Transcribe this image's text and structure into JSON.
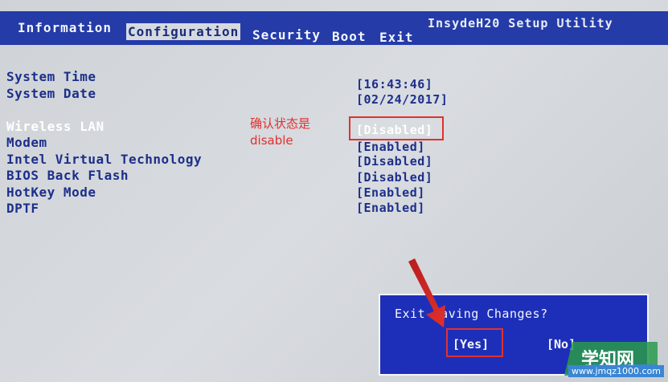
{
  "app_title": "InsydeH20 Setup Utility",
  "tabs": [
    {
      "label": "Information"
    },
    {
      "label": "Configuration"
    },
    {
      "label": "Security"
    },
    {
      "label": "Boot"
    },
    {
      "label": "Exit"
    }
  ],
  "active_tab": "Configuration",
  "settings": [
    {
      "label": "System Time",
      "value": "[16:43:46]"
    },
    {
      "label": "System Date",
      "value": "[02/24/2017]"
    },
    {
      "label": "Wireless LAN",
      "value": "[Disabled]"
    },
    {
      "label": "Modem",
      "value": "[Enabled]"
    },
    {
      "label": "Intel Virtual Technology",
      "value": "[Disabled]"
    },
    {
      "label": "BIOS Back Flash",
      "value": "[Disabled]"
    },
    {
      "label": "HotKey Mode",
      "value": "[Enabled]"
    },
    {
      "label": "DPTF",
      "value": "[Enabled]"
    }
  ],
  "annotation": {
    "line1": "确认状态是",
    "line2": "disable",
    "color": "#e0312f"
  },
  "dialog": {
    "title": "Exit Saving Changes?",
    "yes_label": "[Yes]",
    "no_label": "[No]"
  },
  "watermark": {
    "text": "学知网",
    "url": "www.jmqz1000.com"
  },
  "colors": {
    "topbar": "#243ba8",
    "text_blue": "#1c2f8a",
    "dialog_bg": "#1d2fb8",
    "highlight": "#e0312f"
  }
}
